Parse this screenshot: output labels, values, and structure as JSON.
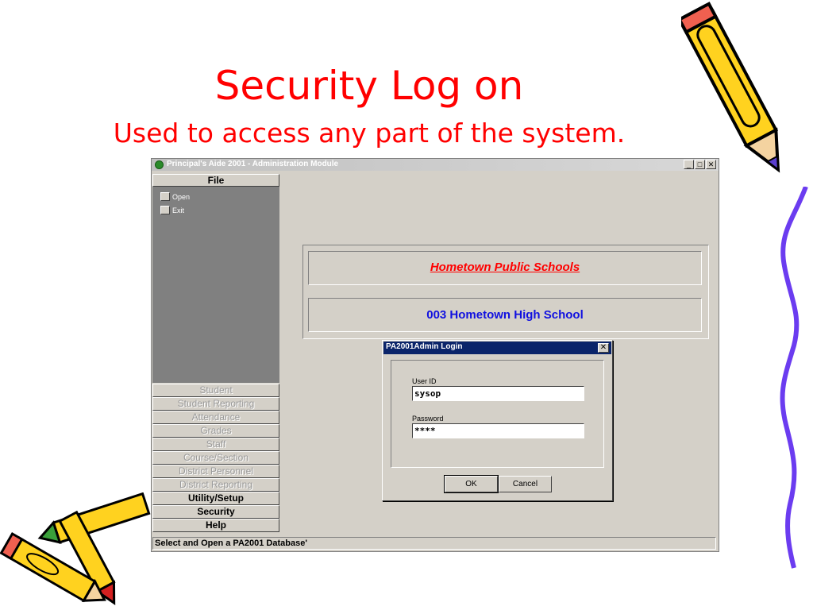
{
  "slide": {
    "title": "Security Log on",
    "subtitle": "Used to access any part of the system."
  },
  "window": {
    "title": "Principal's Aide 2001 - Administration Module",
    "controls": {
      "minimize": "_",
      "maximize": "□",
      "close": "✕"
    }
  },
  "sidebar": {
    "file_header": "File",
    "file_items": [
      {
        "label": "Open"
      },
      {
        "label": "Exit"
      }
    ],
    "nav_items": [
      {
        "label": "Student",
        "active": false
      },
      {
        "label": "Student Reporting",
        "active": false
      },
      {
        "label": "Attendance",
        "active": false
      },
      {
        "label": "Grades",
        "active": false
      },
      {
        "label": "Staff",
        "active": false
      },
      {
        "label": "Course/Section",
        "active": false
      },
      {
        "label": "District Personnel",
        "active": false
      },
      {
        "label": "District Reporting",
        "active": false
      },
      {
        "label": "Utility/Setup",
        "active": true
      },
      {
        "label": "Security",
        "active": true
      },
      {
        "label": "Help",
        "active": true
      }
    ]
  },
  "main": {
    "organization": "Hometown Public Schools",
    "school": "003 Hometown High School"
  },
  "login_dialog": {
    "title": "PA2001Admin Login",
    "close": "✕",
    "user_id_label": "User ID",
    "user_id_value": "sysop",
    "password_label": "Password",
    "password_value": "****",
    "ok_label": "OK",
    "cancel_label": "Cancel"
  },
  "status_bar": {
    "text": "Select and Open a PA2001 Database'"
  },
  "colors": {
    "slide_title": "#ff0000",
    "organization_text": "#ff0000",
    "school_text": "#1010e0",
    "dialog_titlebar": "#0a246a",
    "sidebar_panel": "#808080"
  },
  "decorations": {
    "top_right": "pencil-clipart",
    "bottom_left": "crayons-clipart",
    "right_edge": "squiggle-line"
  }
}
